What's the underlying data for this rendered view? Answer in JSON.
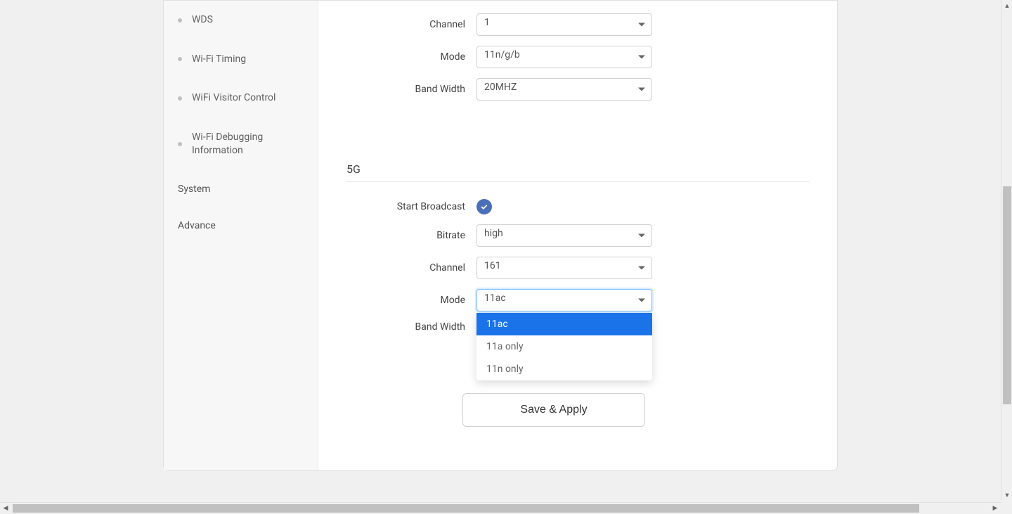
{
  "sidebar": {
    "subItems": [
      {
        "label": "WDS"
      },
      {
        "label": "Wi-Fi Timing"
      },
      {
        "label": "WiFi Visitor Control"
      },
      {
        "label": "Wi-Fi Debugging Information"
      }
    ],
    "mainItems": [
      {
        "label": "System"
      },
      {
        "label": "Advance"
      }
    ]
  },
  "section24": {
    "channel": {
      "label": "Channel",
      "value": "1"
    },
    "mode": {
      "label": "Mode",
      "value": "11n/g/b"
    },
    "bandwidth": {
      "label": "Band Width",
      "value": "20MHZ"
    }
  },
  "section5g": {
    "title": "5G",
    "startBroadcast": {
      "label": "Start Broadcast",
      "checked": true
    },
    "bitrate": {
      "label": "Bitrate",
      "value": "high"
    },
    "channel": {
      "label": "Channel",
      "value": "161"
    },
    "mode": {
      "label": "Mode",
      "value": "11ac"
    },
    "bandwidth": {
      "label": "Band Width",
      "value": ""
    },
    "modeOptions": [
      {
        "label": "11ac",
        "selected": true
      },
      {
        "label": "11a only",
        "selected": false
      },
      {
        "label": "11n only",
        "selected": false
      }
    ]
  },
  "buttons": {
    "saveApply": "Save & Apply"
  }
}
